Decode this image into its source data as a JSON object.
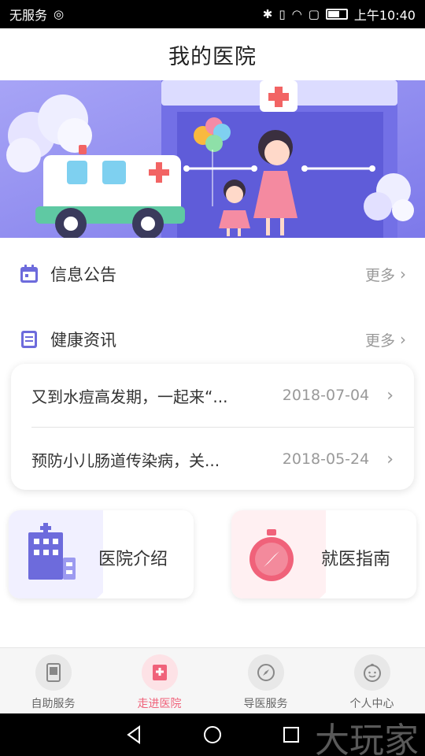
{
  "status_bar": {
    "carrier": "无服务",
    "time": "上午10:40"
  },
  "header": {
    "title": "我的医院"
  },
  "sections": {
    "notice": {
      "title": "信息公告",
      "more": "更多"
    },
    "health": {
      "title": "健康资讯",
      "more": "更多"
    }
  },
  "news": [
    {
      "title": "又到水痘高发期，一起来“...",
      "date": "2018-07-04"
    },
    {
      "title": "预防小儿肠道传染病，关...",
      "date": "2018-05-24"
    }
  ],
  "tiles": {
    "intro": {
      "label": "医院介绍"
    },
    "guide": {
      "label": "就医指南"
    }
  },
  "tabs": [
    {
      "label": "自助服务",
      "icon": "tablet-icon",
      "active": false
    },
    {
      "label": "走进医院",
      "icon": "hospital-icon",
      "active": true
    },
    {
      "label": "导医服务",
      "icon": "compass-icon",
      "active": false
    },
    {
      "label": "个人中心",
      "icon": "baby-face-icon",
      "active": false
    }
  ],
  "watermark": "大玩家",
  "colors": {
    "accent": "#f0627a",
    "purple": "#6d6bdc",
    "banner_bg": "#8c88f2"
  }
}
